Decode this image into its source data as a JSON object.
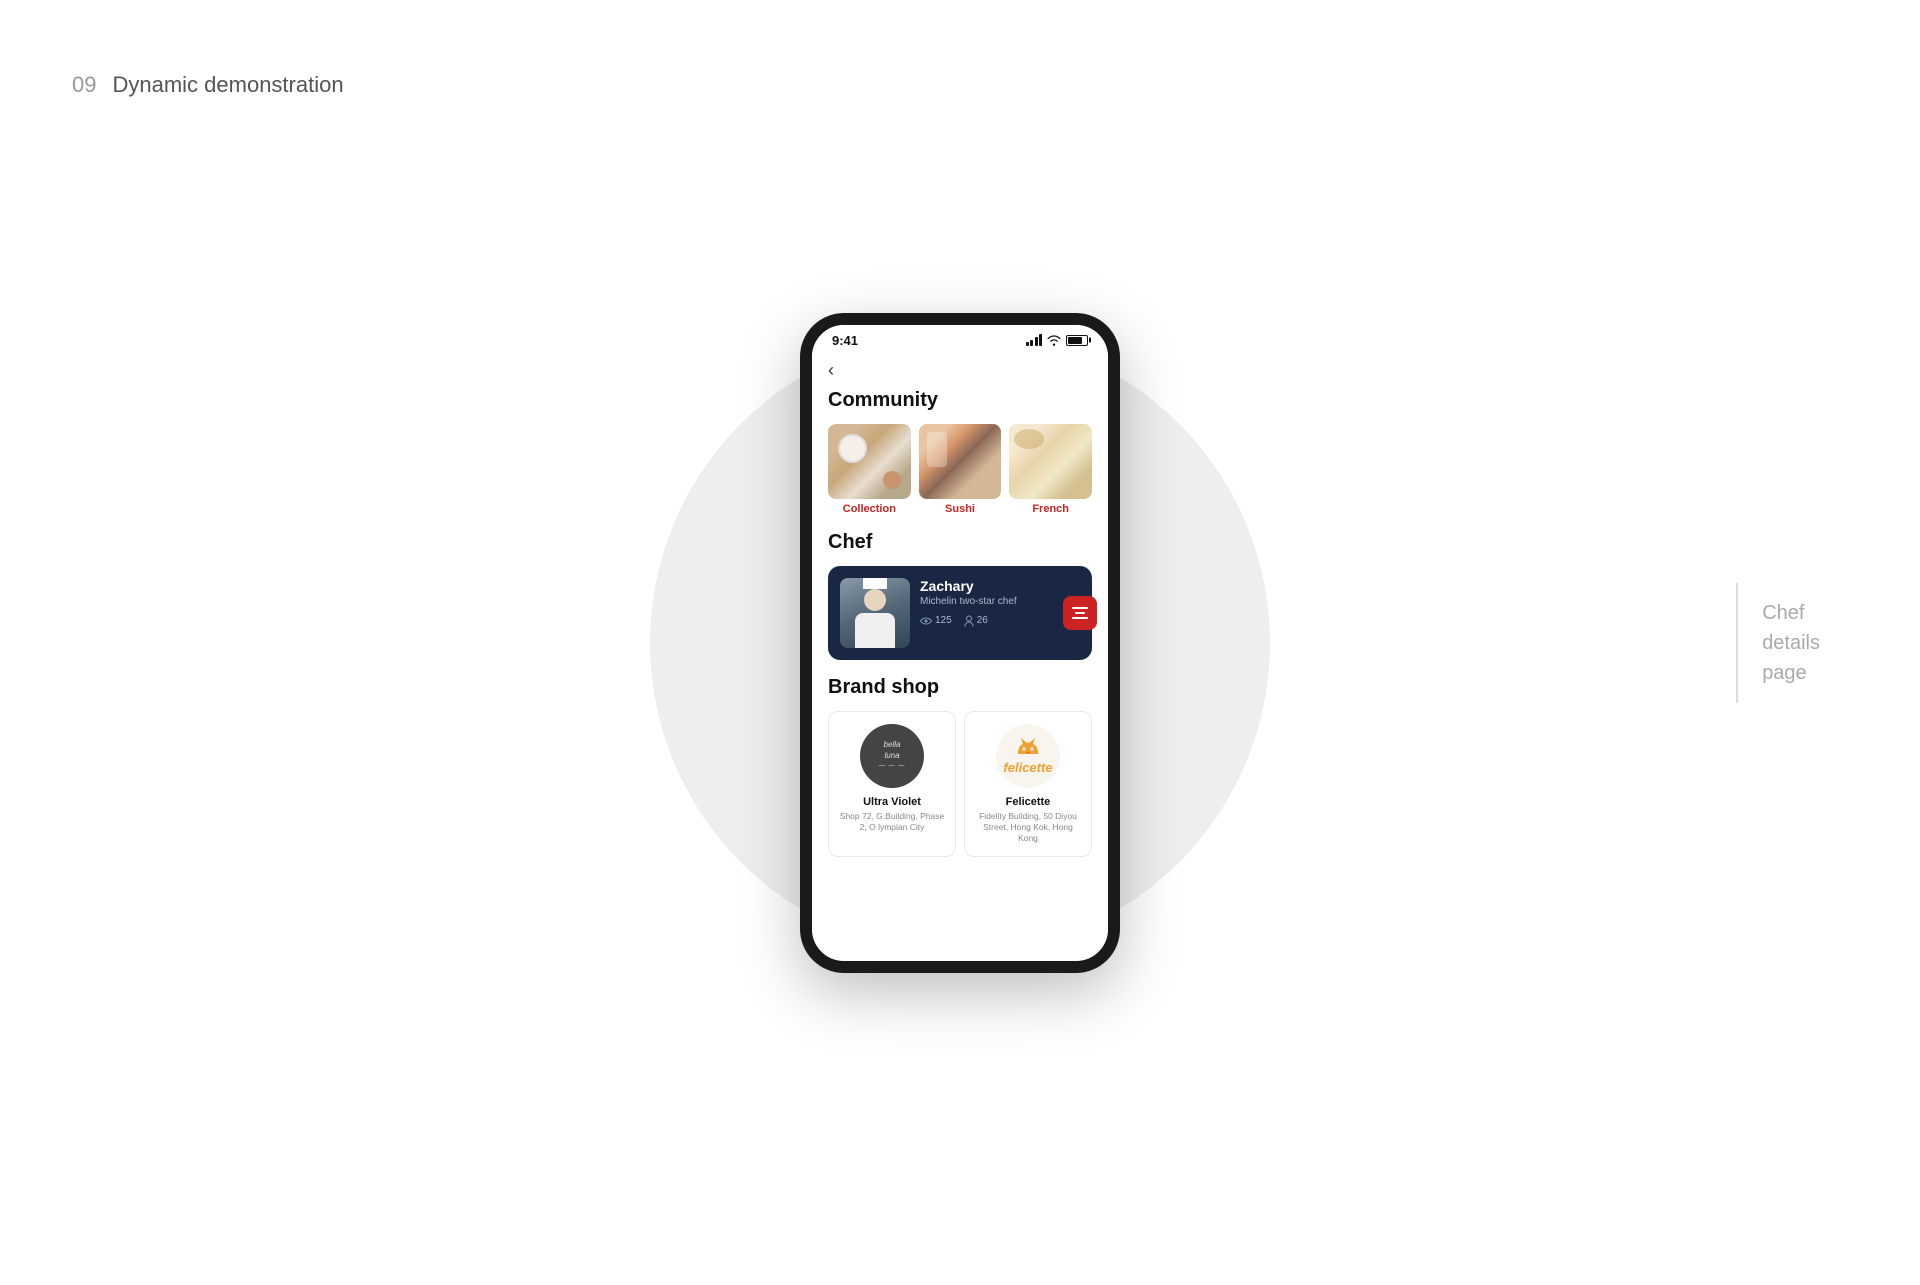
{
  "page": {
    "number": "09",
    "title": "Dynamic demonstration"
  },
  "right_label": {
    "line1": "Chef",
    "line2": "details",
    "line3": "page"
  },
  "phone": {
    "status_bar": {
      "time": "9:41",
      "signal": "●●●",
      "wifi": "wifi",
      "battery": "battery"
    },
    "back_button": "‹",
    "sections": {
      "community": {
        "title": "Community",
        "items": [
          {
            "label": "Collection",
            "img_type": "collection"
          },
          {
            "label": "Sushi",
            "img_type": "sushi"
          },
          {
            "label": "French",
            "img_type": "french"
          }
        ]
      },
      "chef": {
        "title": "Chef",
        "card": {
          "name": "Zachary",
          "description": "Michelin two-star chef",
          "views": "125",
          "followers": "26"
        }
      },
      "brand_shop": {
        "title": "Brand shop",
        "brands": [
          {
            "name": "Ultra Violet",
            "logo_text": "bella\nluna",
            "address": "Shop 72, G.Building, Phase 2, O lympian City"
          },
          {
            "name": "Felicette",
            "logo_text": "felicette",
            "address": "Fidelity Building, 50 Diyou Street, Hong Kok, Hong Kong"
          }
        ]
      }
    }
  }
}
